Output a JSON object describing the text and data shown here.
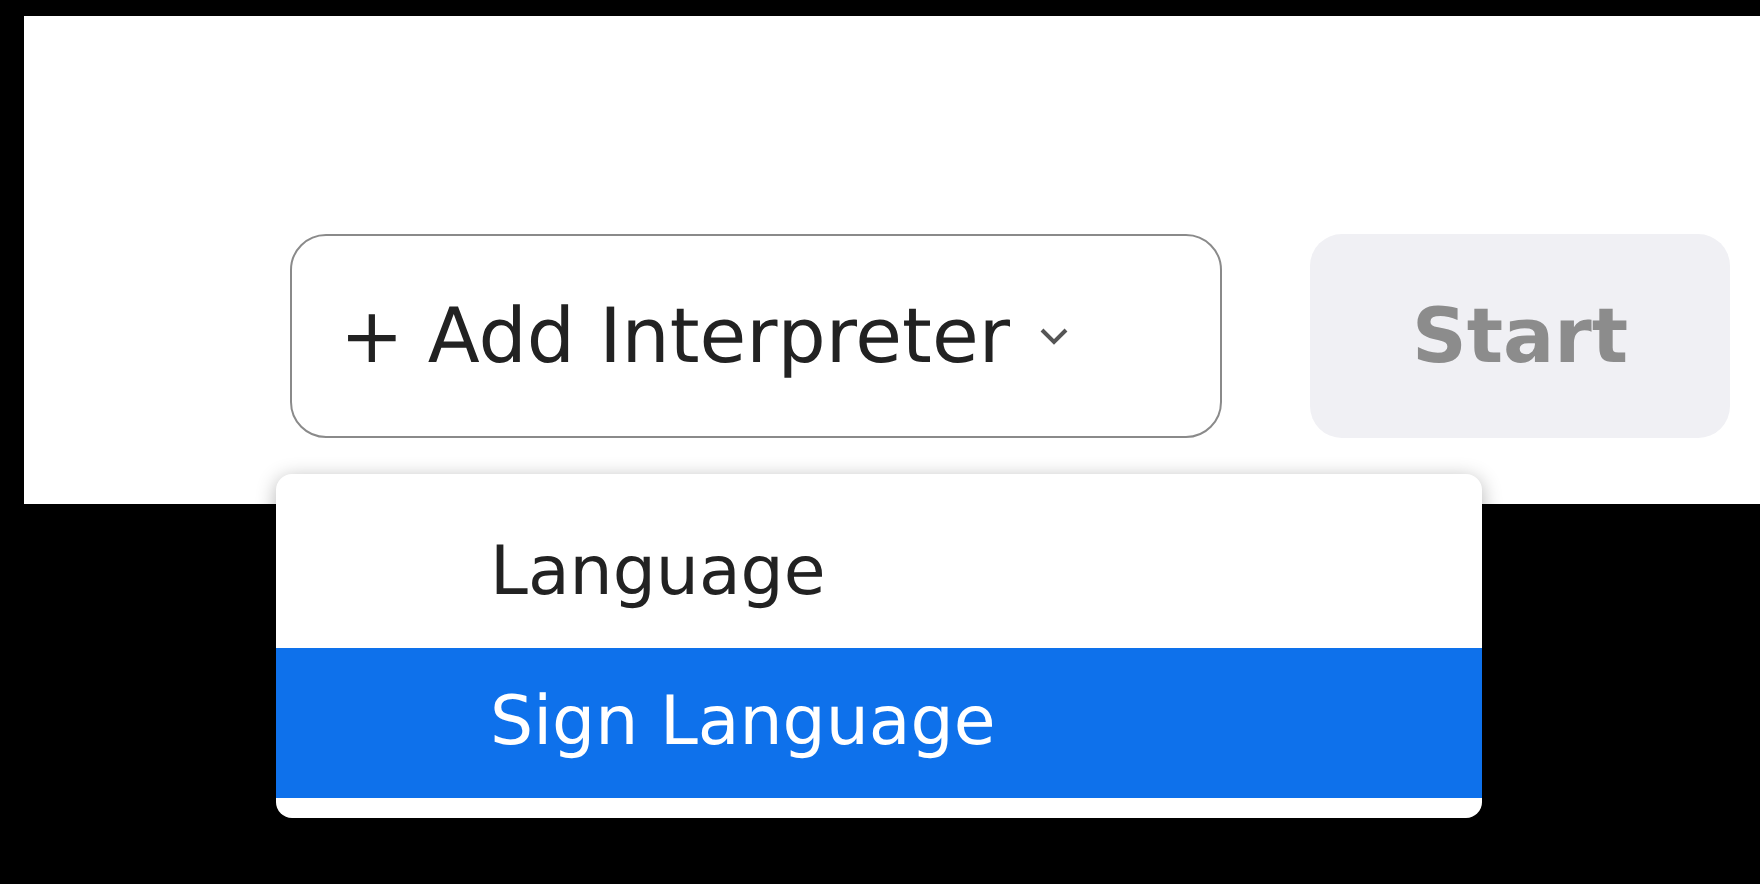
{
  "add_button": {
    "label": "+ Add Interpreter",
    "expanded": true
  },
  "start_button": {
    "label": "Start",
    "disabled": true
  },
  "menu": {
    "items": [
      {
        "label": "Language",
        "selected": false
      },
      {
        "label": "Sign Language",
        "selected": true
      }
    ]
  }
}
